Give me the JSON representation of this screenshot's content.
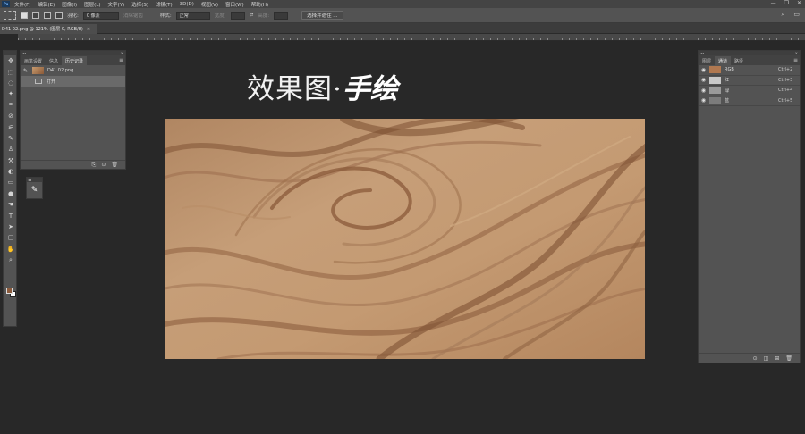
{
  "menubar": {
    "logo": "Ps",
    "items": [
      "文件(F)",
      "编辑(E)",
      "图像(I)",
      "图层(L)",
      "文字(Y)",
      "选择(S)",
      "滤镜(T)",
      "3D(D)",
      "视图(V)",
      "窗口(W)",
      "帮助(H)"
    ],
    "window_controls": [
      "—",
      "❐",
      "✕"
    ]
  },
  "options": {
    "feather_label": "羽化:",
    "feather_value": "0 像素",
    "antialias_label": "消除锯齿",
    "style_label": "样式:",
    "style_value": "正常",
    "width_label": "宽度:",
    "height_label": "高度:",
    "swap_icon": "⇄",
    "select_mask_button": "选择并遮住 ...",
    "search_icon": "⌕",
    "workspace_icon": "▭"
  },
  "document": {
    "tab_title": "D41 02.png @ 121% (图层 0, RGB/8)",
    "close": "×"
  },
  "toolbox": {
    "tools": [
      "✥",
      "⬚",
      "◌",
      "✦",
      "⌗",
      "⊘",
      "⚟",
      "✎",
      "♙",
      "⚒",
      "◐",
      "▭",
      "●",
      "☚",
      "T",
      "➤",
      "▢",
      "✋",
      "⌕",
      "···"
    ]
  },
  "history_panel": {
    "tabs": [
      "画笔设置",
      "信息",
      "历史记录"
    ],
    "active_tab": "历史记录",
    "snapshot_name": "D41 02.png",
    "states": [
      "打开"
    ],
    "footer_icons": [
      "⎘",
      "⊙",
      "🗑"
    ]
  },
  "brush_mini": {
    "icon": "✎"
  },
  "canvas": {
    "title_main": "效果图·",
    "title_script": "手绘"
  },
  "channels_panel": {
    "tabs": [
      "图层",
      "通道",
      "路径"
    ],
    "active_tab": "通道",
    "channels": [
      {
        "name": "RGB",
        "shortcut": "Ctrl+2",
        "color": "#b07850"
      },
      {
        "name": "红",
        "shortcut": "Ctrl+3",
        "color": "#c8c8c8"
      },
      {
        "name": "绿",
        "shortcut": "Ctrl+4",
        "color": "#9a9a9a"
      },
      {
        "name": "蓝",
        "shortcut": "Ctrl+5",
        "color": "#7c7c7c"
      }
    ],
    "footer_icons": [
      "⊙",
      "◫",
      "⊞",
      "🗑"
    ]
  },
  "colors": {
    "foreground": "#8a5a3c",
    "background": "#ffffff"
  }
}
